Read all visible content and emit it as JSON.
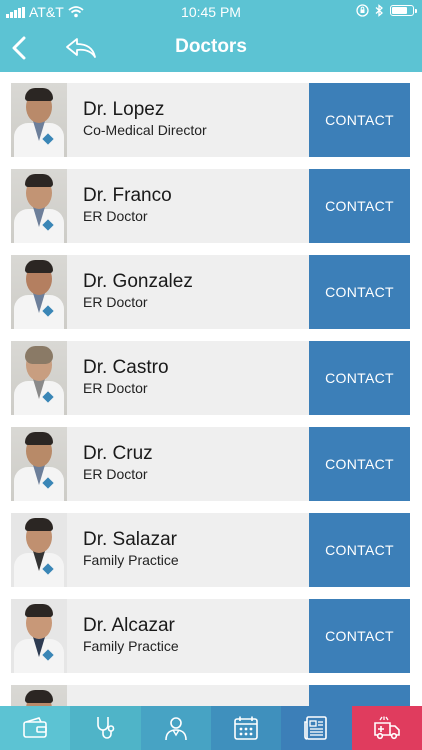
{
  "status_bar": {
    "carrier": "AT&T",
    "time": "10:45 PM",
    "battery_percent": 85
  },
  "header": {
    "title": "Doctors",
    "back_icon": "chevron-left-icon",
    "reply_icon": "reply-arrow-icon"
  },
  "colors": {
    "header_bg": "#5cc3d3",
    "contact_bg": "#3c7fb8",
    "row_bg": "#efefef",
    "emergency_tab": "#e03c5e"
  },
  "doctors": [
    {
      "name": "Dr. Lopez",
      "role": "Co-Medical Director",
      "contact_label": "CONTACT"
    },
    {
      "name": "Dr. Franco",
      "role": "ER Doctor",
      "contact_label": "CONTACT"
    },
    {
      "name": "Dr. Gonzalez",
      "role": "ER Doctor",
      "contact_label": "CONTACT"
    },
    {
      "name": "Dr. Castro",
      "role": "ER Doctor",
      "contact_label": "CONTACT"
    },
    {
      "name": "Dr. Cruz",
      "role": "ER Doctor",
      "contact_label": "CONTACT"
    },
    {
      "name": "Dr. Salazar",
      "role": "Family Practice",
      "contact_label": "CONTACT"
    },
    {
      "name": "Dr. Alcazar",
      "role": "Family Practice",
      "contact_label": "CONTACT"
    },
    {
      "name": "",
      "role": "",
      "contact_label": ""
    }
  ],
  "tab_bar": [
    {
      "icon": "wallet-card-icon",
      "color": "#5cc3d3"
    },
    {
      "icon": "stethoscope-icon",
      "color": "#4fb4c8"
    },
    {
      "icon": "doctor-icon",
      "color": "#47a3c4"
    },
    {
      "icon": "calendar-icon",
      "color": "#3f90bd"
    },
    {
      "icon": "newspaper-icon",
      "color": "#3c7fb8"
    },
    {
      "icon": "ambulance-icon",
      "color": "#e03c5e"
    }
  ]
}
